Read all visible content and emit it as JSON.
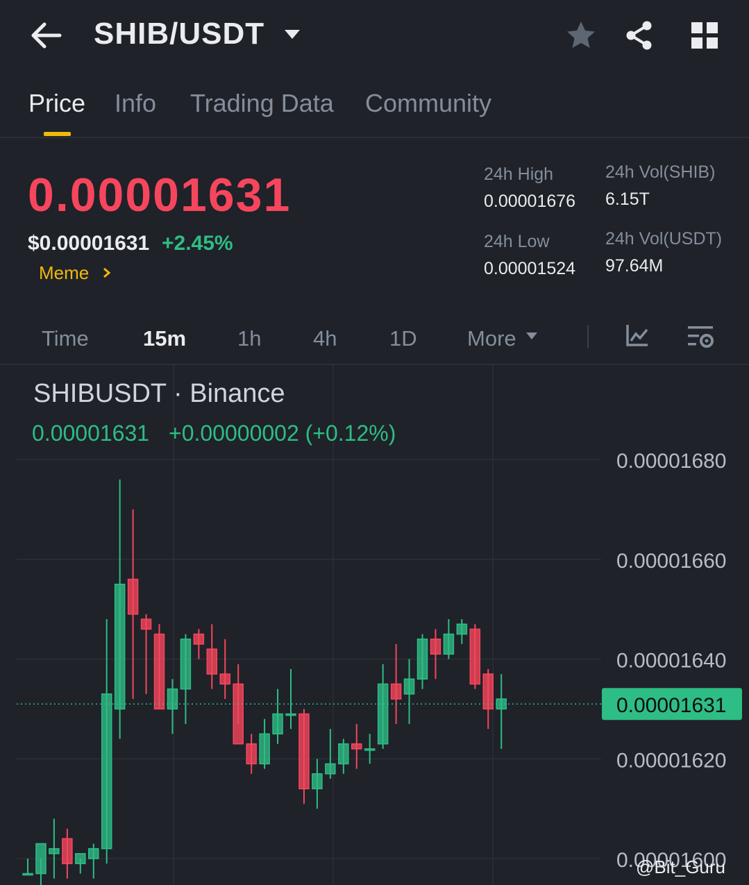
{
  "header": {
    "pair": "SHIB/USDT",
    "icons": [
      "back-arrow-icon",
      "dropdown-caret-icon",
      "star-icon",
      "share-icon",
      "grid-icon"
    ]
  },
  "tabs": [
    {
      "label": "Price",
      "active": true
    },
    {
      "label": "Info",
      "active": false
    },
    {
      "label": "Trading Data",
      "active": false
    },
    {
      "label": "Community",
      "active": false
    }
  ],
  "ticker": {
    "last_price": "0.00001631",
    "usd_price": "$0.00001631",
    "change_pct": "+2.45%",
    "tag": "Meme",
    "high_label": "24h High",
    "high_value": "0.00001676",
    "low_label": "24h Low",
    "low_value": "0.00001524",
    "vol_base_label": "24h Vol(SHIB)",
    "vol_base_value": "6.15T",
    "vol_quote_label": "24h Vol(USDT)",
    "vol_quote_value": "97.64M"
  },
  "intervals": {
    "items": [
      "Time",
      "15m",
      "1h",
      "4h",
      "1D",
      "More"
    ],
    "active": "15m"
  },
  "chart_header": {
    "symbol": "SHIBUSDT · Binance",
    "last": "0.00001631",
    "change": "+0.00000002 (+0.12%)"
  },
  "watermark": "@Bit_Guru",
  "colors": {
    "up": "#2ebd85",
    "down": "#f6465d",
    "accent": "#f0b90b",
    "background": "#1f2228"
  },
  "chart_data": {
    "type": "candlestick",
    "interval": "15m",
    "y_axis_ticks": [
      "0.00001680",
      "0.00001660",
      "0.00001640",
      "0.00001620",
      "0.00001600"
    ],
    "ylim": [
      1.595e-05,
      1.682e-05
    ],
    "current_price_label": "0.00001631",
    "current_price": 1.631e-05,
    "candles": [
      {
        "o": 1.597e-05,
        "h": 1.6e-05,
        "l": 1.597e-05,
        "c": 1.597e-05
      },
      {
        "o": 1.597e-05,
        "h": 1.6e-05,
        "l": 1.594e-05,
        "c": 1.603e-05
      },
      {
        "o": 1.601e-05,
        "h": 1.608e-05,
        "l": 1.596e-05,
        "c": 1.602e-05
      },
      {
        "o": 1.604e-05,
        "h": 1.606e-05,
        "l": 1.596e-05,
        "c": 1.599e-05
      },
      {
        "o": 1.599e-05,
        "h": 1.6e-05,
        "l": 1.597e-05,
        "c": 1.601e-05
      },
      {
        "o": 1.6e-05,
        "h": 1.603e-05,
        "l": 1.596e-05,
        "c": 1.602e-05
      },
      {
        "o": 1.602e-05,
        "h": 1.648e-05,
        "l": 1.599e-05,
        "c": 1.633e-05
      },
      {
        "o": 1.63e-05,
        "h": 1.676e-05,
        "l": 1.624e-05,
        "c": 1.655e-05
      },
      {
        "o": 1.656e-05,
        "h": 1.67e-05,
        "l": 1.632e-05,
        "c": 1.649e-05
      },
      {
        "o": 1.648e-05,
        "h": 1.649e-05,
        "l": 1.633e-05,
        "c": 1.646e-05
      },
      {
        "o": 1.645e-05,
        "h": 1.647e-05,
        "l": 1.63e-05,
        "c": 1.63e-05
      },
      {
        "o": 1.63e-05,
        "h": 1.636e-05,
        "l": 1.625e-05,
        "c": 1.634e-05
      },
      {
        "o": 1.634e-05,
        "h": 1.645e-05,
        "l": 1.627e-05,
        "c": 1.644e-05
      },
      {
        "o": 1.645e-05,
        "h": 1.646e-05,
        "l": 1.64e-05,
        "c": 1.643e-05
      },
      {
        "o": 1.642e-05,
        "h": 1.647e-05,
        "l": 1.634e-05,
        "c": 1.637e-05
      },
      {
        "o": 1.637e-05,
        "h": 1.644e-05,
        "l": 1.632e-05,
        "c": 1.635e-05
      },
      {
        "o": 1.635e-05,
        "h": 1.639e-05,
        "l": 1.627e-05,
        "c": 1.623e-05
      },
      {
        "o": 1.623e-05,
        "h": 1.625e-05,
        "l": 1.617e-05,
        "c": 1.619e-05
      },
      {
        "o": 1.619e-05,
        "h": 1.628e-05,
        "l": 1.618e-05,
        "c": 1.625e-05
      },
      {
        "o": 1.625e-05,
        "h": 1.634e-05,
        "l": 1.623e-05,
        "c": 1.629e-05
      },
      {
        "o": 1.629e-05,
        "h": 1.638e-05,
        "l": 1.626e-05,
        "c": 1.629e-05
      },
      {
        "o": 1.629e-05,
        "h": 1.63e-05,
        "l": 1.611e-05,
        "c": 1.614e-05
      },
      {
        "o": 1.614e-05,
        "h": 1.62e-05,
        "l": 1.61e-05,
        "c": 1.617e-05
      },
      {
        "o": 1.617e-05,
        "h": 1.626e-05,
        "l": 1.616e-05,
        "c": 1.619e-05
      },
      {
        "o": 1.619e-05,
        "h": 1.624e-05,
        "l": 1.617e-05,
        "c": 1.623e-05
      },
      {
        "o": 1.623e-05,
        "h": 1.627e-05,
        "l": 1.618e-05,
        "c": 1.622e-05
      },
      {
        "o": 1.622e-05,
        "h": 1.625e-05,
        "l": 1.619e-05,
        "c": 1.622e-05
      },
      {
        "o": 1.623e-05,
        "h": 1.639e-05,
        "l": 1.622e-05,
        "c": 1.635e-05
      },
      {
        "o": 1.635e-05,
        "h": 1.643e-05,
        "l": 1.627e-05,
        "c": 1.632e-05
      },
      {
        "o": 1.633e-05,
        "h": 1.64e-05,
        "l": 1.627e-05,
        "c": 1.636e-05
      },
      {
        "o": 1.636e-05,
        "h": 1.645e-05,
        "l": 1.634e-05,
        "c": 1.644e-05
      },
      {
        "o": 1.644e-05,
        "h": 1.646e-05,
        "l": 1.636e-05,
        "c": 1.641e-05
      },
      {
        "o": 1.641e-05,
        "h": 1.648e-05,
        "l": 1.64e-05,
        "c": 1.645e-05
      },
      {
        "o": 1.645e-05,
        "h": 1.648e-05,
        "l": 1.643e-05,
        "c": 1.647e-05
      },
      {
        "o": 1.646e-05,
        "h": 1.647e-05,
        "l": 1.634e-05,
        "c": 1.635e-05
      },
      {
        "o": 1.637e-05,
        "h": 1.638e-05,
        "l": 1.626e-05,
        "c": 1.63e-05
      },
      {
        "o": 1.63e-05,
        "h": 1.637e-05,
        "l": 1.622e-05,
        "c": 1.632e-05
      }
    ]
  }
}
